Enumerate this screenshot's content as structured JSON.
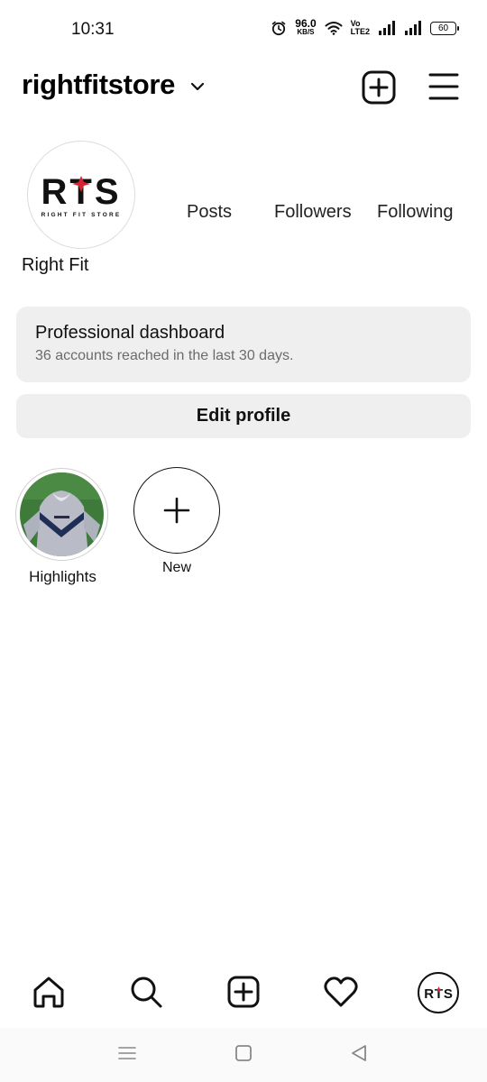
{
  "status_bar": {
    "time": "10:31",
    "speed_value": "96.0",
    "speed_unit": "KB/S",
    "volte_top": "Vo",
    "volte_bottom": "LTE2",
    "battery": "60",
    "icons": [
      "alarm-icon",
      "wifi-icon",
      "signal-icon",
      "signal-icon",
      "battery-icon"
    ]
  },
  "header": {
    "username": "rightfitstore",
    "icons": [
      "chevron-down-icon",
      "create-post-icon",
      "menu-icon"
    ]
  },
  "profile": {
    "logo_text": "RTS",
    "logo_tagline": "RIGHT FIT STORE",
    "stats": {
      "posts_label": "Posts",
      "followers_label": "Followers",
      "following_label": "Following"
    },
    "display_name": "Right Fit"
  },
  "dashboard": {
    "title": "Professional dashboard",
    "subtitle": "36 accounts reached in the last 30 days."
  },
  "edit_profile_label": "Edit profile",
  "highlights": {
    "items": [
      {
        "label": "Highlights"
      }
    ],
    "new_label": "New"
  },
  "bottom_nav": {
    "icons": [
      "home-icon",
      "search-icon",
      "create-icon",
      "heart-icon",
      "profile-avatar"
    ]
  },
  "system_nav": {
    "icons": [
      "recents-icon",
      "home-square-icon",
      "back-icon"
    ]
  },
  "colors": {
    "card_bg": "#efefef",
    "text_secondary": "#6b6b6b",
    "logo_red": "#d7262f"
  }
}
